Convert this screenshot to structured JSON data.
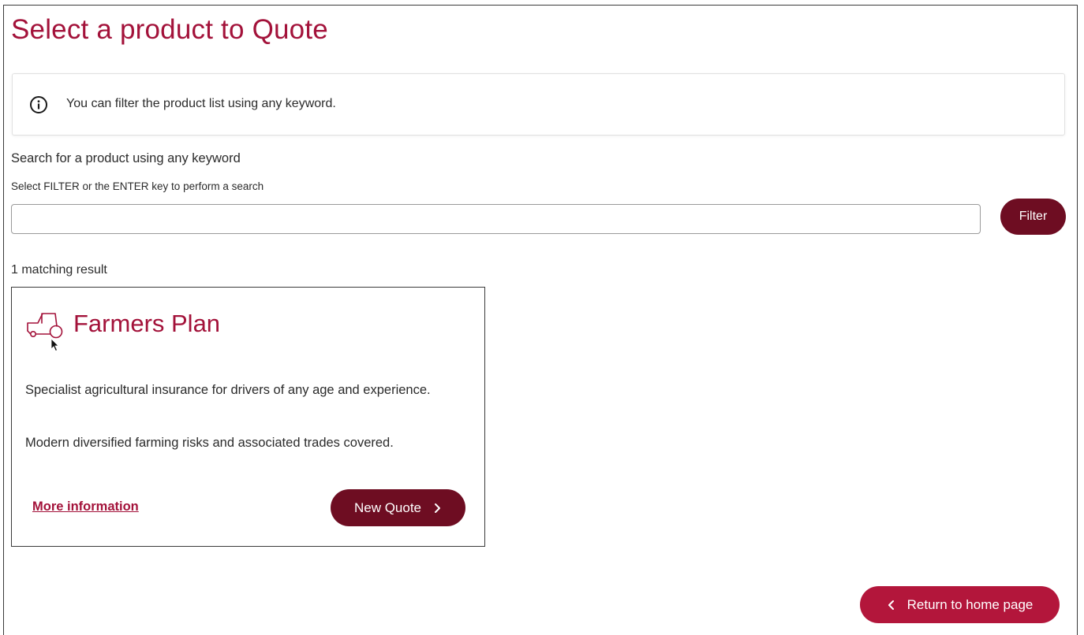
{
  "page": {
    "title": "Select a product to Quote"
  },
  "info_banner": {
    "icon": "info-icon",
    "text": "You can filter the product list using any keyword."
  },
  "search": {
    "label": "Search for a product using any keyword",
    "hint": "Select FILTER or the ENTER key to perform a search",
    "value": "",
    "placeholder": "",
    "filter_label": "Filter"
  },
  "results": {
    "count_text": "1 matching result",
    "products": [
      {
        "icon": "tractor-icon",
        "title": "Farmers Plan",
        "description_1": "Specialist agricultural insurance for drivers of any age and experience.",
        "description_2": "Modern diversified farming risks and associated trades covered.",
        "more_info_label": "More information",
        "new_quote_label": "New Quote"
      }
    ]
  },
  "footer": {
    "return_label": "Return to home page"
  },
  "colors": {
    "brand": "#a3123a",
    "button_dark": "#6e0d22",
    "button_return": "#b3163b",
    "text": "#2b2b2b"
  }
}
